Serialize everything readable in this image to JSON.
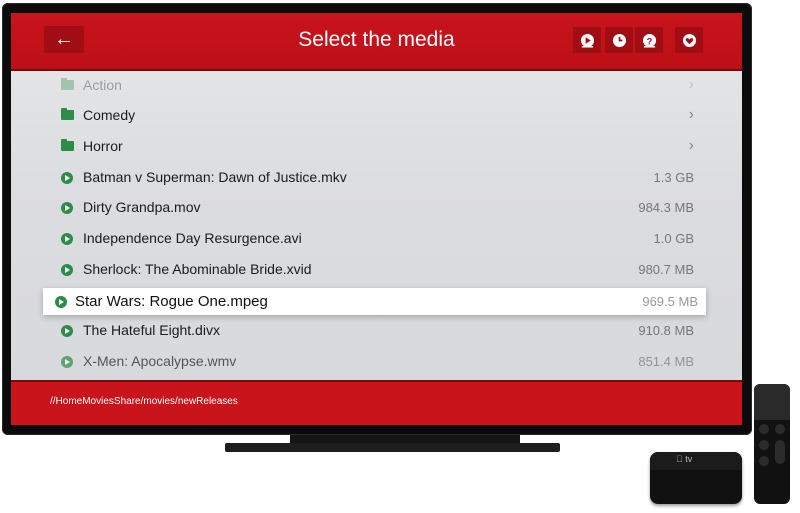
{
  "header": {
    "title": "Select the media",
    "back_icon": "arrow-left-icon",
    "actions": [
      "play-circle-icon",
      "clock-icon",
      "help-icon",
      "heart-icon"
    ],
    "accent_color": "#c9141c"
  },
  "rows": [
    {
      "type": "folder",
      "name": "Action"
    },
    {
      "type": "folder",
      "name": "Comedy"
    },
    {
      "type": "folder",
      "name": "Horror"
    },
    {
      "type": "file",
      "name": "Batman v Superman: Dawn of Justice.mkv",
      "size": "1.3 GB"
    },
    {
      "type": "file",
      "name": "Dirty Grandpa.mov",
      "size": "984.3 MB"
    },
    {
      "type": "file",
      "name": "Independence Day Resurgence.avi",
      "size": "1.0 GB"
    },
    {
      "type": "file",
      "name": "Sherlock: The Abominable Bride.xvid",
      "size": "980.7 MB"
    },
    {
      "type": "file",
      "name": "Star Wars: Rogue One.mpeg",
      "size": "969.5 MB",
      "selected": true
    },
    {
      "type": "file",
      "name": "The Hateful Eight.divx",
      "size": "910.8 MB"
    },
    {
      "type": "file",
      "name": "X-Men: Apocalypse.wmv",
      "size": "851.4 MB"
    }
  ],
  "footer": {
    "path": "//HomeMoviesShare/movies/newReleases"
  },
  "device": {
    "logo_text": "tv"
  }
}
